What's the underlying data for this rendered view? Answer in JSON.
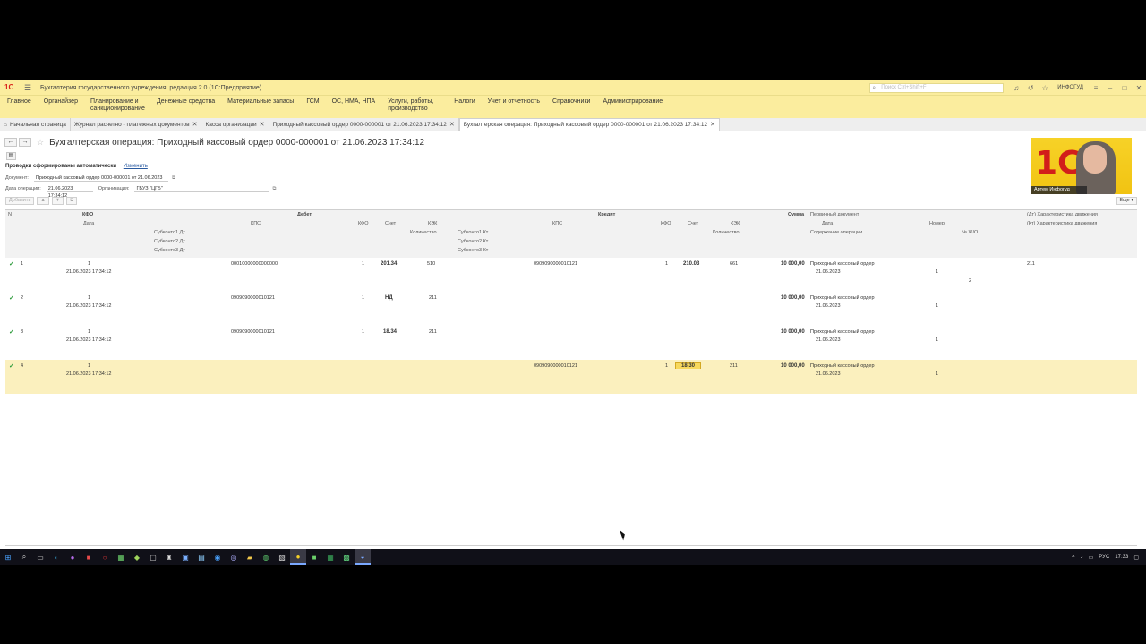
{
  "titlebar": {
    "app_title": "Бухгалтерия государственного учреждения, редакция 2.0  (1С:Предприятие)",
    "search_placeholder": "Поиск Ctrl+Shift+F",
    "user": "ИНФОГУД"
  },
  "menu": [
    "Главное",
    "Органайзер",
    "Планирование и санкционирование",
    "Денежные средства",
    "Материальные запасы",
    "ГСМ",
    "ОС, НМА, НПА",
    "Услуги, работы, производство",
    "Налоги",
    "Учет и отчетность",
    "Справочники",
    "Администрирование"
  ],
  "tabs": [
    {
      "label": "Начальная страница"
    },
    {
      "label": "Журнал расчетно - платежных документов"
    },
    {
      "label": "Касса организации"
    },
    {
      "label": "Приходный кассовый ордер 0000-000001 от 21.06.2023 17:34:12"
    },
    {
      "label": "Бухгалтерская операция: Приходный кассовый ордер 0000-000001 от 21.06.2023 17:34:12"
    }
  ],
  "form": {
    "title": "Бухгалтерская операция: Приходный кассовый ордер 0000-000001 от 21.06.2023 17:34:12",
    "note": "Проводки сформированы автоматически",
    "change_link": "Изменить",
    "document_label": "Документ:",
    "document_value": "Приходный кассовый ордер 0000-000001 от 21.06.2023",
    "date_label": "Дата операции:",
    "date_value": "21.06.2023 17:34:12",
    "org_label": "Организация:",
    "org_value": "ГБУЗ \"ЦГБ\"",
    "add_button": "Добавить",
    "more_button": "Еще"
  },
  "webcam": {
    "name": "Артем Инфогуд"
  },
  "grid": {
    "headers": {
      "n": "N",
      "kfo": "КФО",
      "date": "Дата",
      "debit": "Дебет",
      "credit": "Кредит",
      "kps": "КПС",
      "kfo2": "КФО",
      "account": "Счет",
      "kek": "КЭК",
      "qty": "Количество",
      "sub1_dt": "Субконто1 Дт",
      "sub2_dt": "Субконто2 Дт",
      "sub3_dt": "Субконто3 Дт",
      "sub1_kt": "Субконто1 Кт",
      "sub2_kt": "Субконто2 Кт",
      "sub3_kt": "Субконто3 Кт",
      "sum": "Сумма",
      "primary_doc": "Первичный документ",
      "doc_date": "Дата",
      "doc_num": "Номер",
      "content": "Содержание операции",
      "journal": "№ Ж/О",
      "char_dt": "(Дт) Характеристика движения",
      "char_kt": "(Кт) Характеристика движения"
    },
    "rows": [
      {
        "n": "1",
        "kfo": "1",
        "date": "21.06.2023 17:34:12",
        "dt_kps": "00010000000000000",
        "dt_kfo": "1",
        "dt_acc": "201.34",
        "dt_kek": "510",
        "kt_kps": "0909090000010121",
        "kt_kfo": "1",
        "kt_acc": "210.03",
        "kt_kek": "661",
        "sum": "10 000,00",
        "doc": "Приходный кассовый ордер",
        "doc_date": "21.06.2023",
        "doc_num": "1",
        "journal": "2",
        "char": "211"
      },
      {
        "n": "2",
        "kfo": "1",
        "date": "21.06.2023 17:34:12",
        "dt_kps": "0909090000010121",
        "dt_kfo": "1",
        "dt_acc": "НД",
        "dt_kek": "211",
        "kt_kps": "",
        "kt_kfo": "",
        "kt_acc": "",
        "kt_kek": "",
        "sum": "10 000,00",
        "doc": "Приходный кассовый ордер",
        "doc_date": "21.06.2023",
        "doc_num": "1",
        "journal": "",
        "char": ""
      },
      {
        "n": "3",
        "kfo": "1",
        "date": "21.06.2023 17:34:12",
        "dt_kps": "0909090000010121",
        "dt_kfo": "1",
        "dt_acc": "18.34",
        "dt_kek": "211",
        "kt_kps": "",
        "kt_kfo": "",
        "kt_acc": "",
        "kt_kek": "",
        "sum": "10 000,00",
        "doc": "Приходный кассовый ордер",
        "doc_date": "21.06.2023",
        "doc_num": "1",
        "journal": "",
        "char": ""
      },
      {
        "n": "4",
        "kfo": "1",
        "date": "21.06.2023 17:34:12",
        "dt_kps": "",
        "dt_kfo": "",
        "dt_acc": "",
        "dt_kek": "",
        "kt_kps": "0909090000010121",
        "kt_kfo": "1",
        "kt_acc": "18.30",
        "kt_kek": "211",
        "sum": "10 000,00",
        "doc": "Приходный кассовый ордер",
        "doc_date": "21.06.2023",
        "doc_num": "1",
        "journal": "",
        "char": ""
      }
    ]
  },
  "taskbar": {
    "lang": "РУС",
    "time": "17:33"
  }
}
